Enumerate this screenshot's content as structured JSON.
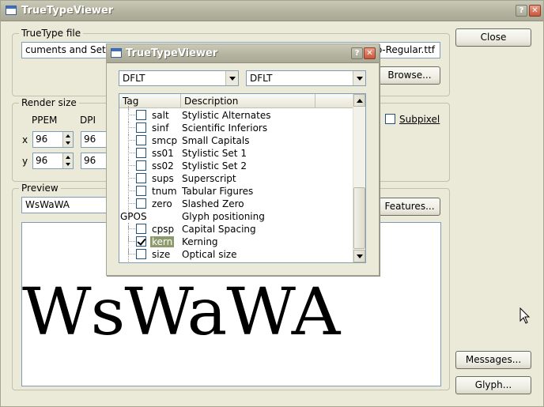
{
  "main_window": {
    "title": "TrueTypeViewer",
    "truetype_group_label": "TrueType file",
    "file_path_left": "cuments and Settin",
    "file_path_right": "p-Regular.ttf",
    "browse_label": "Browse...",
    "close_label": "Close",
    "render_group_label": "Render size",
    "ppem_label": "PPEM",
    "dpi_label": "DPI",
    "x_label": "x",
    "y_label": "y",
    "ppem_x": "96",
    "ppem_y": "96",
    "dpi_x": "96",
    "dpi_y": "96",
    "subpixel_label": "Subpixel",
    "preview_group_label": "Preview",
    "preview_input_value": "WsWaWA",
    "features_label": "Features...",
    "preview_text": "WsWaWA",
    "messages_label": "Messages...",
    "glyph_label": "Glyph..."
  },
  "dialog": {
    "title": "TrueTypeViewer",
    "script_select": "DFLT",
    "language_select": "DFLT",
    "columns": [
      "Tag",
      "Description"
    ],
    "rows": [
      {
        "tag": "salt",
        "desc": "Stylistic Alternates",
        "checked": false,
        "indent": true
      },
      {
        "tag": "sinf",
        "desc": "Scientific Inferiors",
        "checked": false,
        "indent": true
      },
      {
        "tag": "smcp",
        "desc": "Small Capitals",
        "checked": false,
        "indent": true
      },
      {
        "tag": "ss01",
        "desc": "Stylistic Set 1",
        "checked": false,
        "indent": true
      },
      {
        "tag": "ss02",
        "desc": "Stylistic Set 2",
        "checked": false,
        "indent": true
      },
      {
        "tag": "sups",
        "desc": "Superscript",
        "checked": false,
        "indent": true
      },
      {
        "tag": "tnum",
        "desc": "Tabular Figures",
        "checked": false,
        "indent": true
      },
      {
        "tag": "zero",
        "desc": "Slashed Zero",
        "checked": false,
        "indent": true
      },
      {
        "tag": "GPOS",
        "desc": "Glyph positioning",
        "checked": null,
        "indent": false
      },
      {
        "tag": "cpsp",
        "desc": "Capital Spacing",
        "checked": false,
        "indent": true
      },
      {
        "tag": "kern",
        "desc": "Kerning",
        "checked": true,
        "indent": true,
        "selected": true
      },
      {
        "tag": "size",
        "desc": "Optical size",
        "checked": false,
        "indent": true
      }
    ]
  }
}
